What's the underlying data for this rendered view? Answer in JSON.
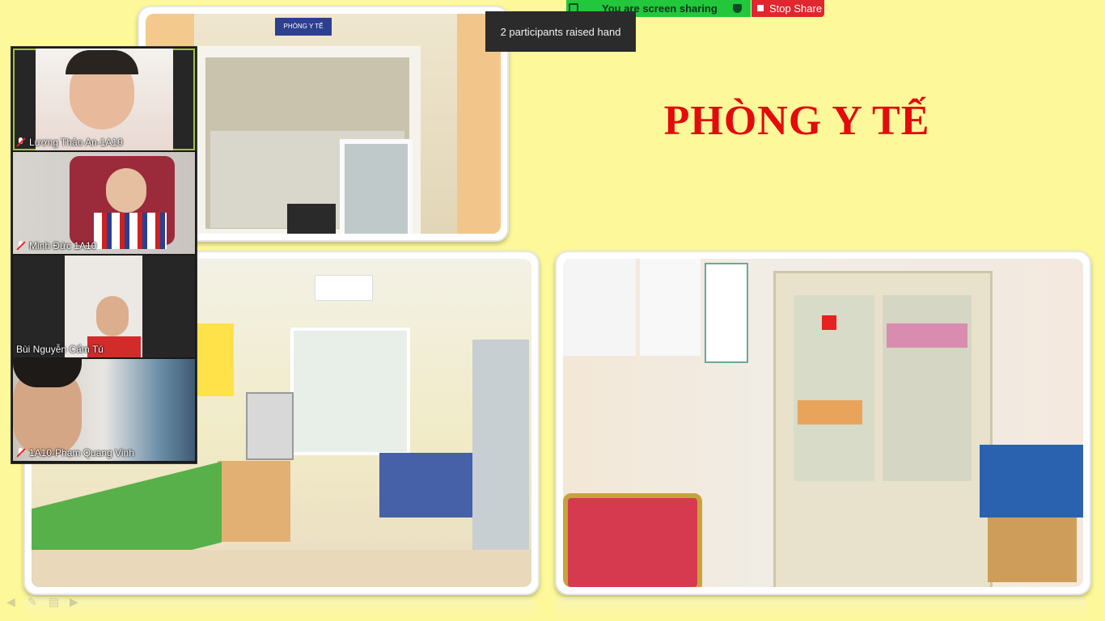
{
  "slide": {
    "title": "PHÒNG Y TẾ",
    "sign_text": "PHÒNG Y TẾ"
  },
  "share_bar": {
    "status": "You are screen sharing",
    "stop_label": "Stop Share"
  },
  "tooltip": {
    "text": "2 participants raised hand"
  },
  "participants": [
    {
      "name": "Lương Thảo An-1A10",
      "muted": true
    },
    {
      "name": "Minh Đức 1A10",
      "muted": true
    },
    {
      "name": "Bùi Nguyễn Cẩm Tú",
      "muted": false
    },
    {
      "name": "1A10-Phạm Quang Vinh",
      "muted": true
    }
  ],
  "icons": {
    "shield": "shield-check-icon",
    "stop": "stop-square-icon",
    "mic": "mic-muted-icon"
  },
  "colors": {
    "slide_bg": "#fdf99a",
    "title": "#e30b0b",
    "share_green": "#22c73c",
    "stop_red": "#e0262e"
  }
}
